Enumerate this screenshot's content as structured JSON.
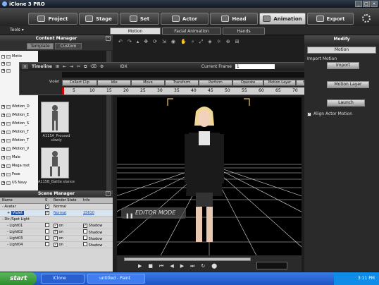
{
  "app": {
    "title": "iClone",
    "title_suffix": "PRO",
    "title_version": "3"
  },
  "main_tabs": [
    {
      "label": "Project"
    },
    {
      "label": "Stage"
    },
    {
      "label": "Set"
    },
    {
      "label": "Actor"
    },
    {
      "label": "Head"
    },
    {
      "label": "Animation",
      "active": true
    },
    {
      "label": "Export"
    }
  ],
  "sub_tabs": [
    {
      "label": "Motion",
      "active": true
    },
    {
      "label": "Facial Animation"
    },
    {
      "label": "Hands"
    }
  ],
  "tools_menu": "Tools",
  "content_manager": {
    "title": "Content Manager",
    "tabs": [
      "Template",
      "Custom"
    ],
    "tree_items": [
      "Motio",
      "",
      "",
      "",
      "",
      "",
      "",
      "",
      "iMotion_D",
      "iMotion_E",
      "iMotion_S",
      "iMotion_T",
      "iMotion_T",
      "iMotion_V",
      "Male",
      "Mega mot",
      "Pose",
      "US Navy"
    ],
    "thumbs": [
      {
        "caption": "A115A_Proceed slowly"
      },
      {
        "caption": "A115B_Battle stance"
      }
    ]
  },
  "timeline": {
    "title": "Timeline",
    "current_frame_label": "Current Frame",
    "current_frame": "1",
    "idx_label": "IDX",
    "track_label": "Violet",
    "cells": [
      "Collect Clip",
      "Idle",
      "Move",
      "Transform",
      "Perform",
      "Operate",
      "Motion Layer",
      "Hands"
    ],
    "ruler": [
      "5",
      "10",
      "15",
      "20",
      "25",
      "30",
      "35",
      "40",
      "45",
      "50",
      "55",
      "60",
      "65",
      "70",
      "75"
    ]
  },
  "scene_manager": {
    "title": "Scene Manager",
    "columns": [
      "Name",
      "S",
      "Render State",
      "Info"
    ],
    "rows": [
      {
        "name": "Avatar",
        "state": "Normal",
        "info": "",
        "indent": 0
      },
      {
        "name": "Violet",
        "state": "Normal",
        "info": "15610",
        "indent": 1,
        "selected": true
      },
      {
        "name": "Dir./Spot Light",
        "state": "",
        "info": "",
        "indent": 0
      },
      {
        "name": "Light01",
        "state": "on",
        "info": "Shadow",
        "indent": 1
      },
      {
        "name": "Light02",
        "state": "on",
        "info": "Shadow",
        "indent": 1
      },
      {
        "name": "Light03",
        "state": "on",
        "info": "Shadow",
        "indent": 1
      },
      {
        "name": "Light04",
        "state": "on",
        "info": "Shadow",
        "indent": 1
      }
    ]
  },
  "viewport": {
    "mode_label": "EDITOR MODE"
  },
  "modify": {
    "title": "Modify",
    "dropdown": "Motion",
    "import_label": "Import Motion",
    "import_button": "Import",
    "motion_layer_button": "Motion Layer",
    "launch_button": "Launch",
    "align_label": "Align Actor Motion"
  },
  "taskbar": {
    "start": "start",
    "tasks": [
      "iClone",
      "untitled - Paint"
    ],
    "clock": "3:11 PM"
  }
}
